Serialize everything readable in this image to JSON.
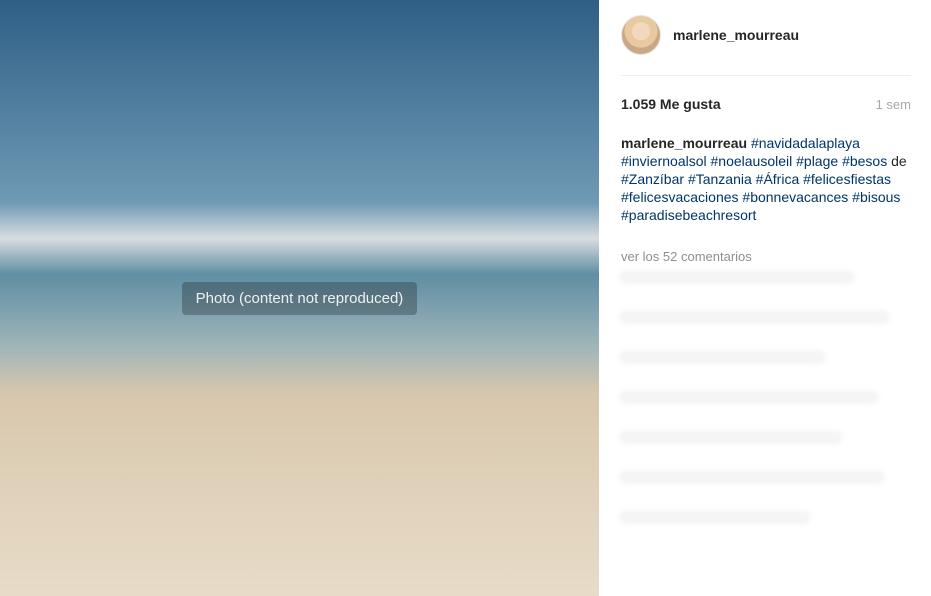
{
  "post": {
    "username": "marlene_mourreau",
    "follow_label": "",
    "likes": "1.059 Me gusta",
    "time": "1 sem",
    "caption_user": "marlene_mourreau",
    "caption_parts": [
      {
        "t": "#navidadalaplaya",
        "tag": true
      },
      {
        "t": " ",
        "tag": false
      },
      {
        "t": "#inviernoalsol",
        "tag": true
      },
      {
        "t": " ",
        "tag": false
      },
      {
        "t": "#noelausoleil",
        "tag": true
      },
      {
        "t": " ",
        "tag": false
      },
      {
        "t": "#plage",
        "tag": true
      },
      {
        "t": " ",
        "tag": false
      },
      {
        "t": "#besos",
        "tag": true
      },
      {
        "t": " de ",
        "tag": false
      },
      {
        "t": "#Zanzíbar",
        "tag": true
      },
      {
        "t": " ",
        "tag": false
      },
      {
        "t": "#Tanzania",
        "tag": true
      },
      {
        "t": " ",
        "tag": false
      },
      {
        "t": "#África",
        "tag": true
      },
      {
        "t": " ",
        "tag": false
      },
      {
        "t": "#felicesfiestas",
        "tag": true
      },
      {
        "t": " ",
        "tag": false
      },
      {
        "t": "#felicesvacaciones",
        "tag": true
      },
      {
        "t": " ",
        "tag": false
      },
      {
        "t": "#bonnevacances",
        "tag": true
      },
      {
        "t": " ",
        "tag": false
      },
      {
        "t": "#bisous",
        "tag": true
      },
      {
        "t": " ",
        "tag": false
      },
      {
        "t": "#paradisebeachresort",
        "tag": true
      }
    ],
    "view_comments": "ver los 52 comentarios"
  },
  "photo": {
    "placeholder": "Photo (content not reproduced)"
  },
  "colors": {
    "text": "#262626",
    "muted": "#8e8e8e",
    "hashtag": "#003569"
  }
}
